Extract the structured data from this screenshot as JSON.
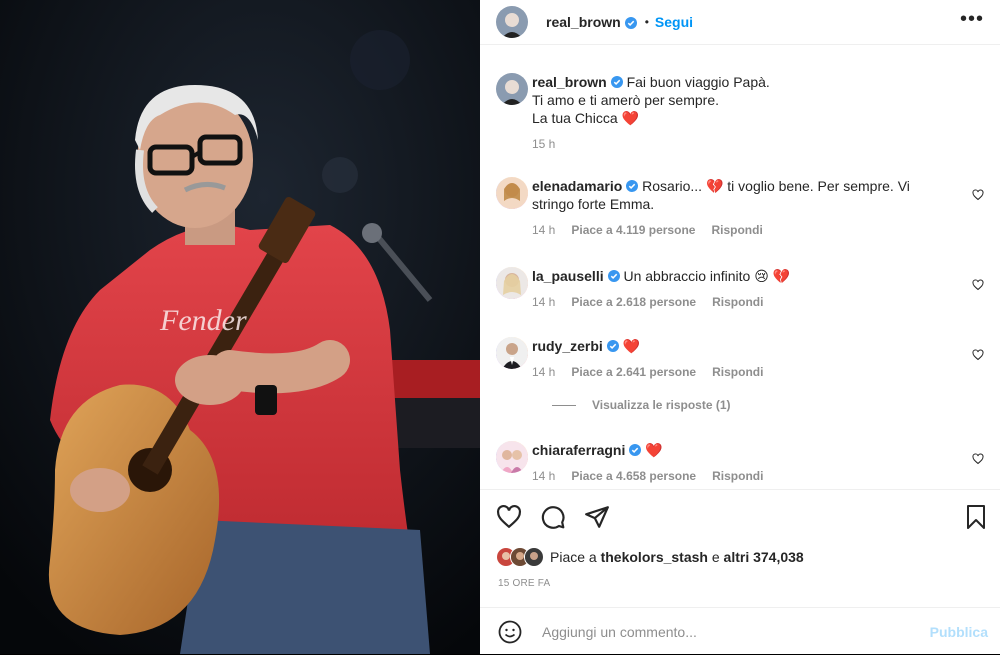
{
  "post": {
    "author": "real_brown",
    "follow_label": "Segui",
    "more_label": "•••"
  },
  "caption": {
    "username": "real_brown",
    "lines": [
      "Fai buon viaggio Papà.",
      "Ti amo e ti amerò per sempre.",
      "La tua Chicca ❤️"
    ],
    "time": "15 h"
  },
  "comments": [
    {
      "username": "elenadamario",
      "text": "Rosario... 💔 ti voglio bene. Per sempre. Vi stringo forte Emma.",
      "time": "14 h",
      "likes": "Piace a 4.119 persone",
      "reply": "Rispondi"
    },
    {
      "username": "la_pauselli",
      "text": "Un abbraccio infinito 😢 💔",
      "time": "14 h",
      "likes": "Piace a 2.618 persone",
      "reply": "Rispondi"
    },
    {
      "username": "rudy_zerbi",
      "text": "❤️",
      "time": "14 h",
      "likes": "Piace a 2.641 persone",
      "reply": "Rispondi"
    },
    {
      "username": "chiaraferragni",
      "text": "❤️",
      "time": "14 h",
      "likes": "Piace a 4.658 persone",
      "reply": "Rispondi"
    }
  ],
  "view_replies": "Visualizza le risposte (1)",
  "likes_summary": {
    "prefix": "Piace a",
    "user": "thekolors_stash",
    "connector": "e",
    "others": "altri 374,038"
  },
  "post_time": "15 ORE FA",
  "add_comment": {
    "placeholder": "Aggiungi un commento...",
    "publish_label": "Pubblica"
  },
  "colors": {
    "accent": "#0095f6",
    "verified": "#3897f0",
    "publish_disabled": "#b2dffc",
    "shirt": "#d7373a"
  },
  "icons": [
    "verified-badge-icon",
    "more-icon",
    "heart-icon",
    "comment-icon",
    "share-icon",
    "save-icon",
    "emoji-icon"
  ]
}
